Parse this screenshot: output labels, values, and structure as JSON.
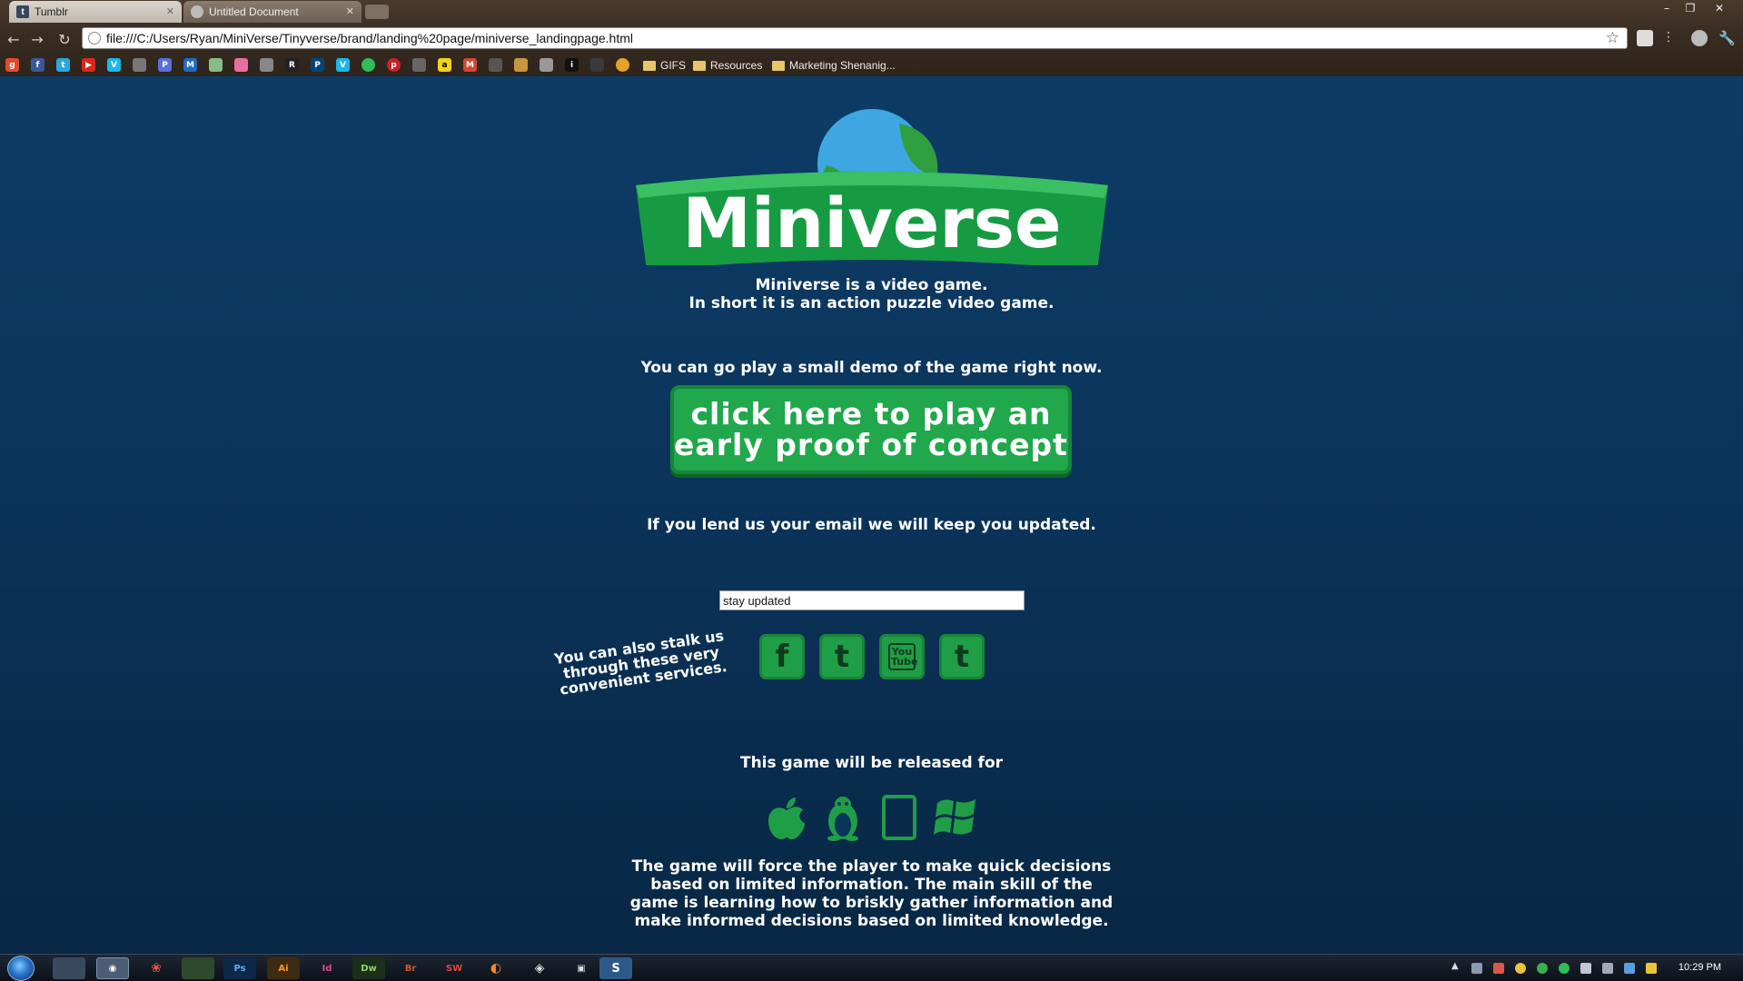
{
  "browser": {
    "tabs": [
      {
        "label": "Tumblr",
        "favicon": "tumblr-icon",
        "active": false
      },
      {
        "label": "Untitled Document",
        "favicon": "page-icon",
        "active": true
      }
    ],
    "url": "file:///C:/Users/Ryan/MiniVerse/Tinyverse/brand/landing%20page/miniverse_landingpage.html",
    "bookmark_folders": [
      "GIFS",
      "Resources",
      "Marketing Shenanig..."
    ]
  },
  "page": {
    "logo_text": "Miniverse",
    "intro_line1": "Miniverse is a video game.",
    "intro_line2": "In short it is an action puzzle video game.",
    "demo_prompt": "You can go play a small demo of the game right now.",
    "cta_label": "click here to play an early proof of concept",
    "email_prompt": "If you lend us your email we will keep you updated.",
    "email_value": "stay updated",
    "stalk_text": "You can also stalk us through these very convenient services.",
    "social": [
      {
        "name": "facebook",
        "glyph": "f"
      },
      {
        "name": "twitter",
        "glyph": "t"
      },
      {
        "name": "youtube",
        "glyph": "You Tube"
      },
      {
        "name": "tumblr",
        "glyph": "t"
      }
    ],
    "release_label": "This game will be released for",
    "platforms": [
      "apple-icon",
      "linux-icon",
      "tablet-icon",
      "windows-icon"
    ],
    "description": "The game will force the player to make quick decisions based on limited information. The main skill of the game is learning how to briskly gather information and make informed decisions based on limited knowledge."
  },
  "taskbar": {
    "clock": "10:29 PM"
  },
  "colors": {
    "background": "#0b345b",
    "accent_green": "#21a74c",
    "dark_green": "#15873a"
  }
}
